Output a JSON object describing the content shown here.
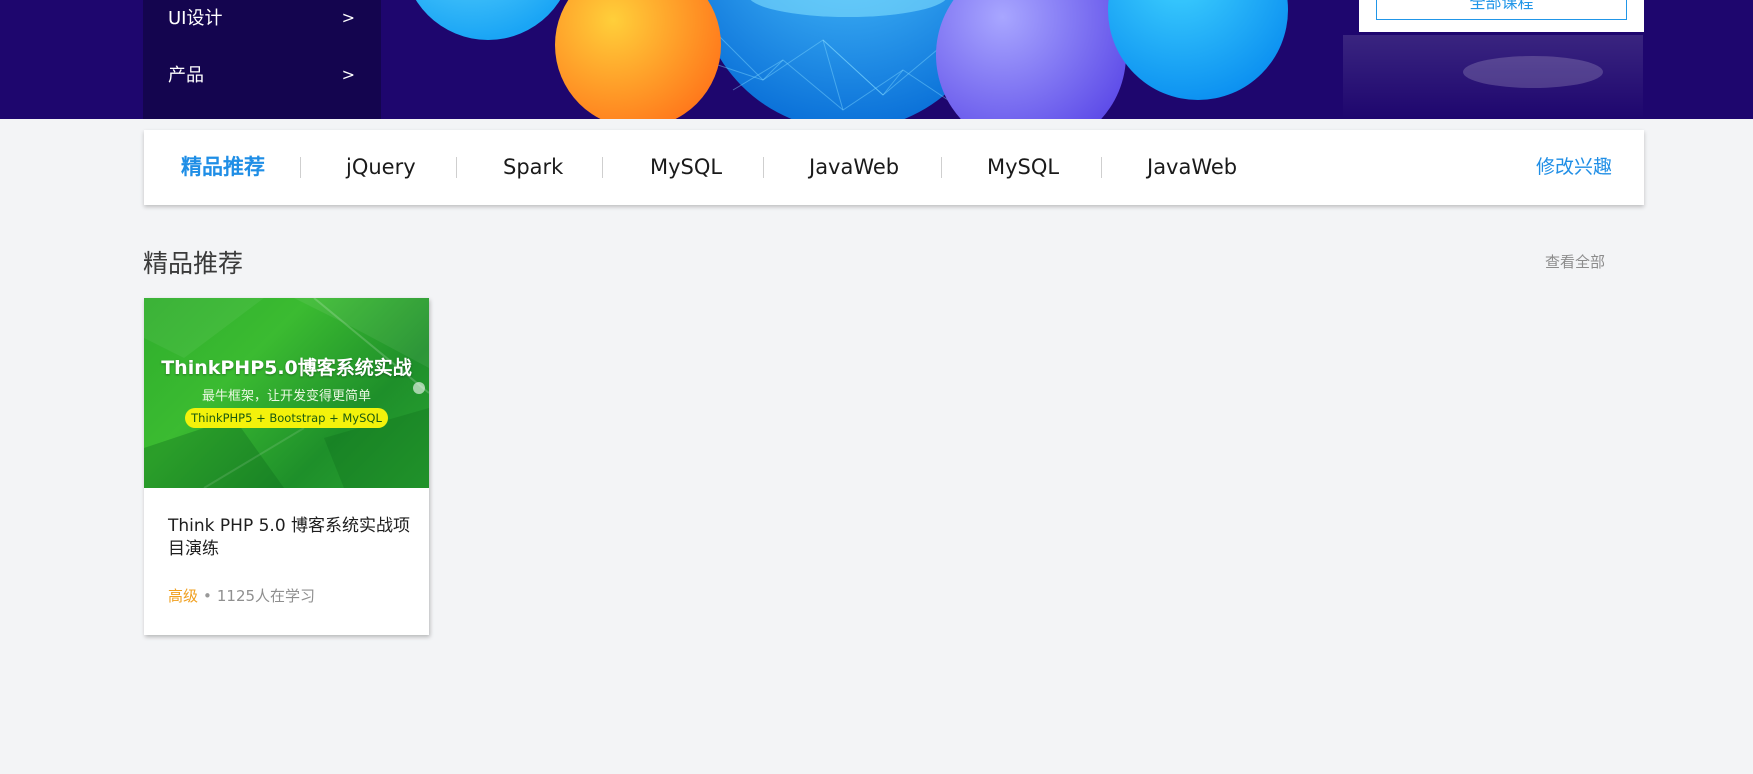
{
  "banner": {
    "categories": [
      {
        "label": "UI设计",
        "arrow": ">"
      },
      {
        "label": "产品",
        "arrow": ">"
      }
    ],
    "all_courses_button": "全部课程"
  },
  "tag_nav": {
    "tags": [
      "精品推荐",
      "jQuery",
      "Spark",
      "MySQL",
      "JavaWeb",
      "MySQL",
      "JavaWeb"
    ],
    "active_index": 0,
    "edit_interest": "修改兴趣"
  },
  "section": {
    "title": "精品推荐",
    "view_all": "查看全部"
  },
  "courses": [
    {
      "cover_title": "ThinkPHP5.0博客系统实战",
      "cover_subtitle": "最牛框架，让开发变得更简单",
      "cover_stack": "ThinkPHP5 + Bootstrap + MySQL",
      "name": "Think PHP 5.0 博客系统实战项目演练",
      "level": "高级",
      "separator": "•",
      "learners": "1125人在学习"
    }
  ],
  "colors": {
    "banner_bg": "#1e066e",
    "accent": "#1f8ee6",
    "level": "#f0a020",
    "page_bg": "#f3f4f6"
  }
}
